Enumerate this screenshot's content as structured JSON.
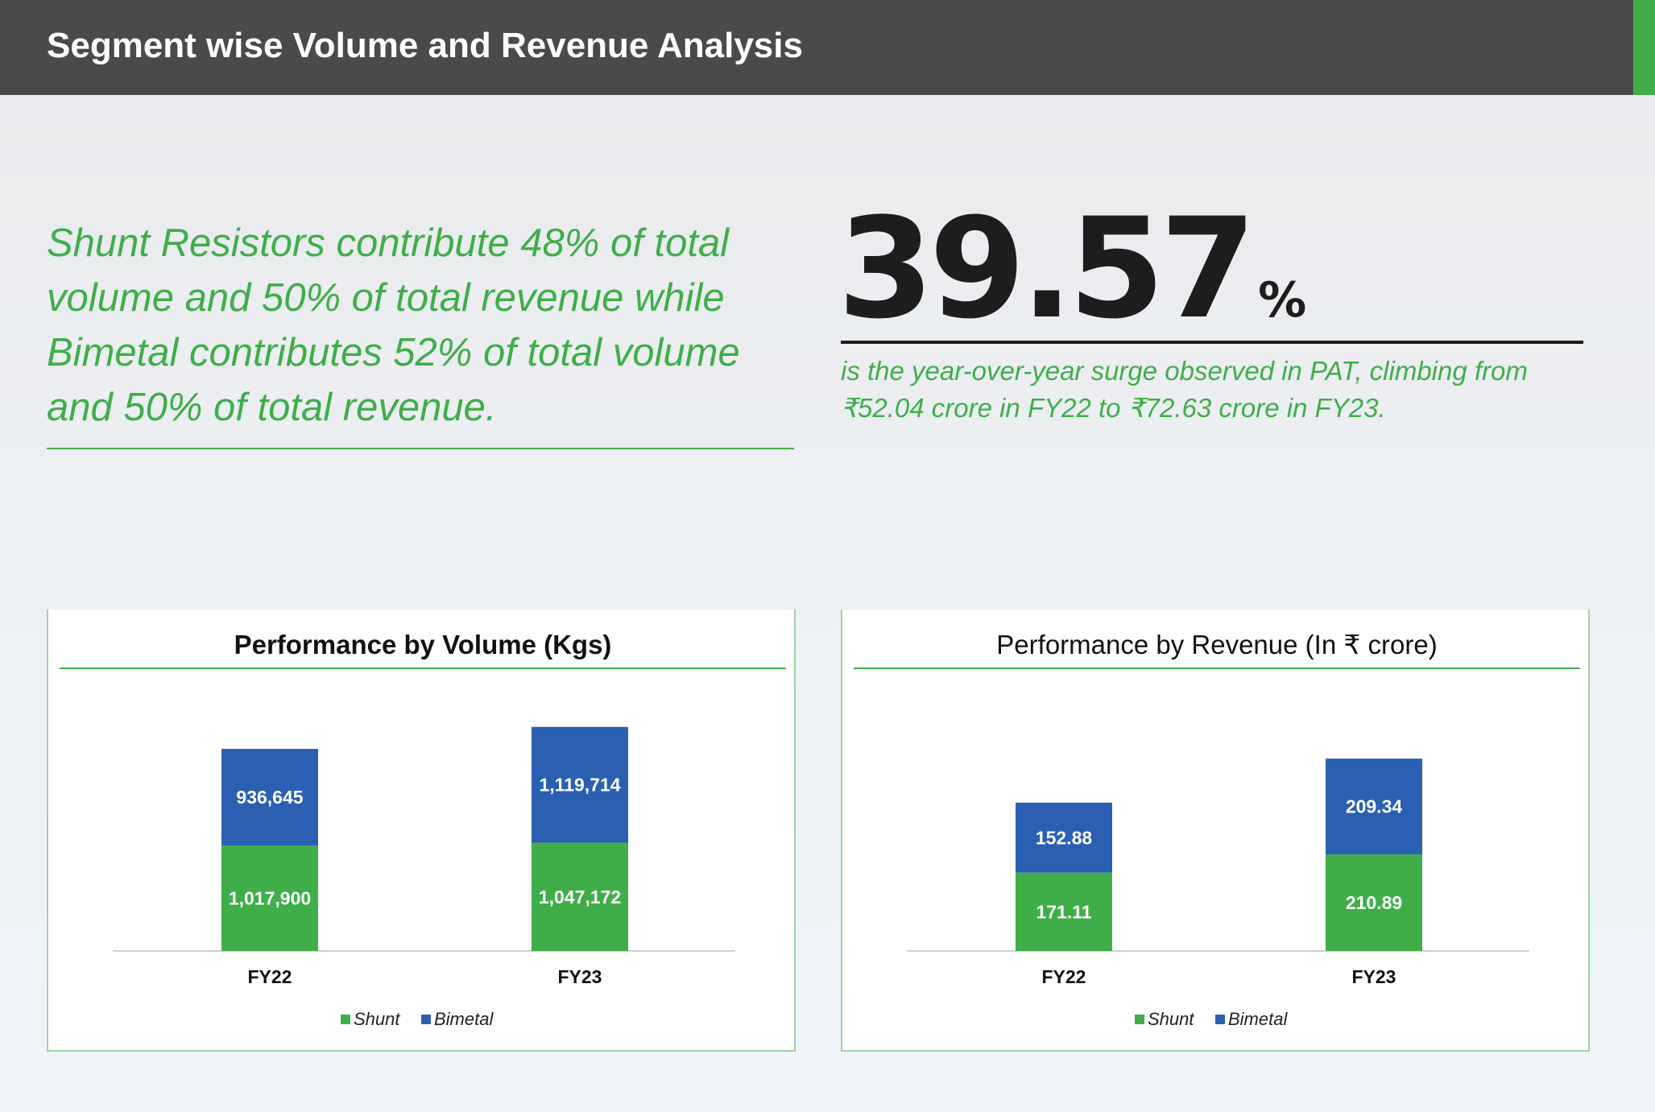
{
  "header": {
    "title": "Segment wise Volume and Revenue Analysis"
  },
  "summary": {
    "text": "Shunt Resistors contribute 48% of total volume and 50% of total revenue while Bimetal contributes 52% of total volume and 50% of total revenue."
  },
  "highlight": {
    "value": "39.57",
    "unit": "%",
    "caption": "is the year-over-year surge observed in PAT, climbing from ₹52.04 crore in FY22 to ₹72.63 crore in FY23."
  },
  "colors": {
    "shunt": "#3fae49",
    "bimetal": "#2b5fb1",
    "accent": "#3fae49",
    "header": "#4a4a4a"
  },
  "chart_data": [
    {
      "type": "bar",
      "stacked": true,
      "title": "Performance by Volume (Kgs)",
      "categories": [
        "FY22",
        "FY23"
      ],
      "series": [
        {
          "name": "Shunt",
          "values": [
            1017900,
            1047172
          ],
          "labels": [
            "1,017,900",
            "1,047,172"
          ]
        },
        {
          "name": "Bimetal",
          "values": [
            936645,
            1119714
          ],
          "labels": [
            "936,645",
            "1,119,714"
          ]
        }
      ],
      "legend": "bottom-center",
      "grid": false
    },
    {
      "type": "bar",
      "stacked": true,
      "title": "Performance by Revenue (In ₹ crore)",
      "categories": [
        "FY22",
        "FY23"
      ],
      "series": [
        {
          "name": "Shunt",
          "values": [
            171.11,
            210.89
          ],
          "labels": [
            "171.11",
            "210.89"
          ]
        },
        {
          "name": "Bimetal",
          "values": [
            152.88,
            209.34
          ],
          "labels": [
            "152.88",
            "209.34"
          ]
        }
      ],
      "legend": "bottom-center",
      "grid": false
    }
  ]
}
